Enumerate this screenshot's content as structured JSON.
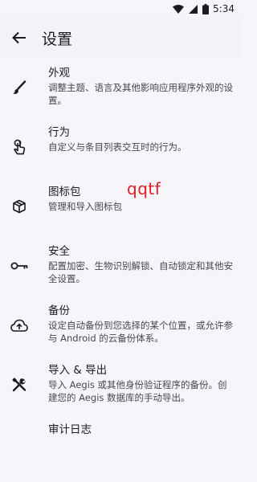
{
  "status_bar": {
    "time": "5:34",
    "icons": [
      "wifi-icon",
      "signal-icon",
      "battery-icon"
    ]
  },
  "app_bar": {
    "title": "设置",
    "back_icon": "arrow-back-icon"
  },
  "settings": [
    {
      "id": "appearance",
      "icon": "brush-icon",
      "title": "外观",
      "subtitle": "调整主题、语言及其他影响应用程序外观的设置。"
    },
    {
      "id": "behavior",
      "icon": "touch-icon",
      "title": "行为",
      "subtitle": "自定义与条目列表交互时的行为。"
    },
    {
      "id": "icon-packs",
      "icon": "package-icon",
      "title": "图标包",
      "subtitle": "管理和导入图标包"
    },
    {
      "id": "security",
      "icon": "key-icon",
      "title": "安全",
      "subtitle": "配置加密、生物识别解锁、自动锁定和其他安全设置。"
    },
    {
      "id": "backups",
      "icon": "cloud-upload-icon",
      "title": "备份",
      "subtitle": "设定自动备份到您选择的某个位置，或允许参与 Android 的云备份体系。"
    },
    {
      "id": "import-export",
      "icon": "tools-icon",
      "title": "导入 & 导出",
      "subtitle": "导入 Aegis 或其他身份验证程序的备份。创建您的 Aegis 数据库的手动导出。"
    },
    {
      "id": "audit-log",
      "icon": "audit-icon",
      "title": "审计日志",
      "subtitle": ""
    }
  ],
  "annotation": "qqtf"
}
